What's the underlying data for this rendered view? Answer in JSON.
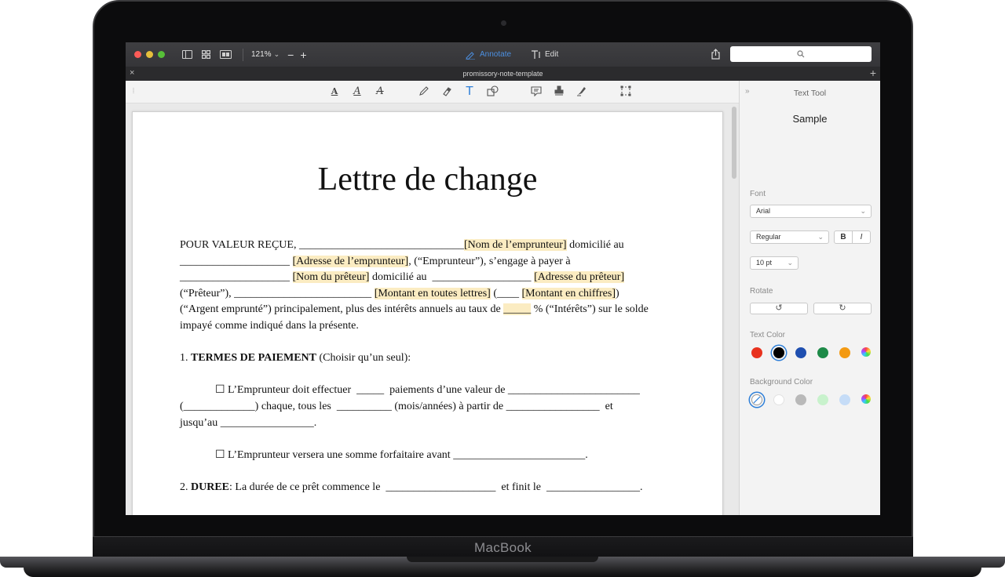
{
  "device": {
    "brand": "MacBook"
  },
  "titlebar": {
    "zoom": "121%",
    "zoom_out": "−",
    "zoom_in": "+",
    "annotate_label": "Annotate",
    "edit_label": "Edit"
  },
  "tabbar": {
    "document_name": "promissory-note-template",
    "close": "×",
    "add": "+"
  },
  "toolbar": {
    "tools": [
      "text-box-icon",
      "text-underline-icon",
      "text-strikethrough-icon",
      "pencil-icon",
      "eraser-icon",
      "text-tool-icon",
      "shapes-icon",
      "note-icon",
      "stamp-icon",
      "signature-icon",
      "selection-icon"
    ]
  },
  "document": {
    "title": "Lettre de change",
    "lines": [
      {
        "segments": [
          {
            "t": "POUR VALEUR REÇUE, ______________________________",
            "hl": false
          },
          {
            "t": "[Nom de l’emprunteur]",
            "hl": true
          },
          {
            "t": " domicilié au",
            "hl": false
          }
        ]
      },
      {
        "segments": [
          {
            "t": "____________________ ",
            "hl": false
          },
          {
            "t": "[Adresse de l’emprunteur]",
            "hl": true
          },
          {
            "t": ", (“Emprunteur”), s’engage à payer à",
            "hl": false
          }
        ]
      },
      {
        "segments": [
          {
            "t": "____________________ ",
            "hl": false
          },
          {
            "t": "[Nom du prêteur]",
            "hl": true
          },
          {
            "t": " domicilié au  __________________ ",
            "hl": false
          },
          {
            "t": "[Adresse du prêteur]",
            "hl": true
          }
        ]
      },
      {
        "segments": [
          {
            "t": "(“Prêteur”), _________________________ ",
            "hl": false
          },
          {
            "t": "[Montant en toutes lettres]",
            "hl": true
          },
          {
            "t": " (____ ",
            "hl": false
          },
          {
            "t": "[Montant en chiffres]",
            "hl": true
          },
          {
            "t": ")",
            "hl": false
          }
        ]
      },
      {
        "segments": [
          {
            "t": "(“Argent emprunté”) principalement, plus des intérêts annuels au taux de ",
            "hl": false
          },
          {
            "t": "_____",
            "hl": true
          },
          {
            "t": " % (“Intérêts”) sur le solde",
            "hl": false
          }
        ]
      },
      {
        "segments": [
          {
            "t": "impayé comme indiqué dans la présente.",
            "hl": false
          }
        ]
      }
    ],
    "section1_number": "1. ",
    "section1_heading": "TERMES DE PAIEMENT",
    "section1_note": " (Choisir qu’un seul):",
    "option1_line1": "☐ L’Emprunteur doit effectuer  _____  paiements d’une valeur de ________________________",
    "option1_line2": "(_____________) chaque, tous les  __________ (mois/années) à partir de _________________  et",
    "option1_line3": "jusqu’au _________________.",
    "option2": "☐ L’Emprunteur versera une somme forfaitaire avant ________________________.",
    "section2_number": "2. ",
    "section2_heading": "DUREE",
    "section2_text": ": La durée de ce prêt commence le  ____________________  et finit le  _________________."
  },
  "sidebar": {
    "title": "Text Tool",
    "sample": "Sample",
    "font_label": "Font",
    "font_value": "Arial",
    "style_value": "Regular",
    "bold": "B",
    "italic": "I",
    "size_value": "10 pt",
    "rotate_label": "Rotate",
    "rotate_left": "↺",
    "rotate_right": "↻",
    "text_color_label": "Text Color",
    "text_colors": [
      "#e8321e",
      "#000000",
      "#1f4fb0",
      "#1d8a48",
      "#f39a12",
      "multicolor"
    ],
    "text_color_selected": "#000000",
    "background_color_label": "Background Color",
    "background_colors": [
      "none",
      "#ffffff",
      "#b9b9b9",
      "#c8f2cc",
      "#c5dcf7",
      "multicolor"
    ],
    "background_color_selected": "none"
  }
}
